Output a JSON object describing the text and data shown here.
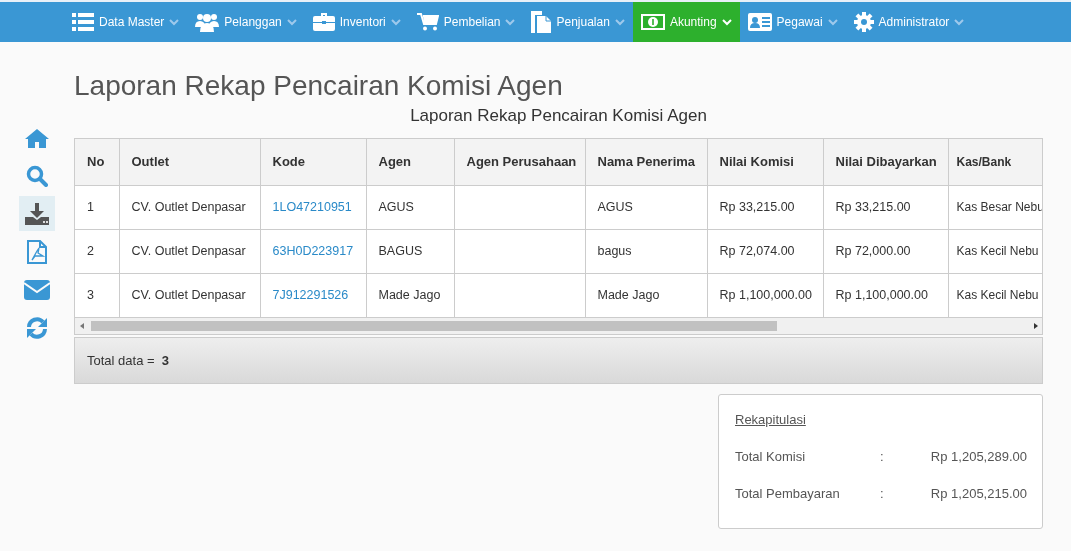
{
  "navbar": {
    "items": [
      {
        "label": "Data Master",
        "selected": false
      },
      {
        "label": "Pelanggan",
        "selected": false
      },
      {
        "label": "Inventori",
        "selected": false
      },
      {
        "label": "Pembelian",
        "selected": false
      },
      {
        "label": "Penjualan",
        "selected": false
      },
      {
        "label": "Akunting",
        "selected": true
      },
      {
        "label": "Pegawai",
        "selected": false
      },
      {
        "label": "Administrator",
        "selected": false
      }
    ]
  },
  "sidebar": {
    "items": [
      {
        "selected": false
      },
      {
        "selected": false
      },
      {
        "selected": true
      },
      {
        "selected": false
      },
      {
        "selected": false
      },
      {
        "selected": false
      }
    ]
  },
  "page_title": "Laporan Rekap Pencairan Komisi Agen",
  "report_title": "Laporan Rekap Pencairan Komisi Agen",
  "table": {
    "columns": [
      "No",
      "Outlet",
      "Kode",
      "Agen",
      "Agen Perusahaan",
      "Nama Penerima",
      "Nilai Komisi",
      "Nilai Dibayarkan",
      "Kas/Bank"
    ],
    "rows": [
      [
        "1",
        "CV. Outlet Denpasar",
        "1LO47210951",
        "AGUS",
        "",
        "AGUS",
        "Rp 33,215.00",
        "Rp 33,215.00",
        "Kas Besar Nebu"
      ],
      [
        "2",
        "CV. Outlet Denpasar",
        "63H0D223917",
        "BAGUS",
        "",
        "bagus",
        "Rp 72,074.00",
        "Rp 72,000.00",
        "Kas Kecil Nebu"
      ],
      [
        "3",
        "CV. Outlet Denpasar",
        "7J912291526",
        "Made Jago",
        "",
        "Made Jago",
        "Rp 1,100,000.00",
        "Rp 1,100,000.00",
        "Kas Kecil Nebu"
      ]
    ],
    "footer": "Total data =  **3**"
  },
  "recap": {
    "title": "Rekapitulasi",
    "rows": [
      {
        "label": "Total Komisi",
        "separator": ":",
        "value": "Rp 1,205,289.00"
      },
      {
        "label": "Total Pembayaran",
        "separator": ":",
        "value": "Rp 1,205,215.00"
      }
    ]
  }
}
